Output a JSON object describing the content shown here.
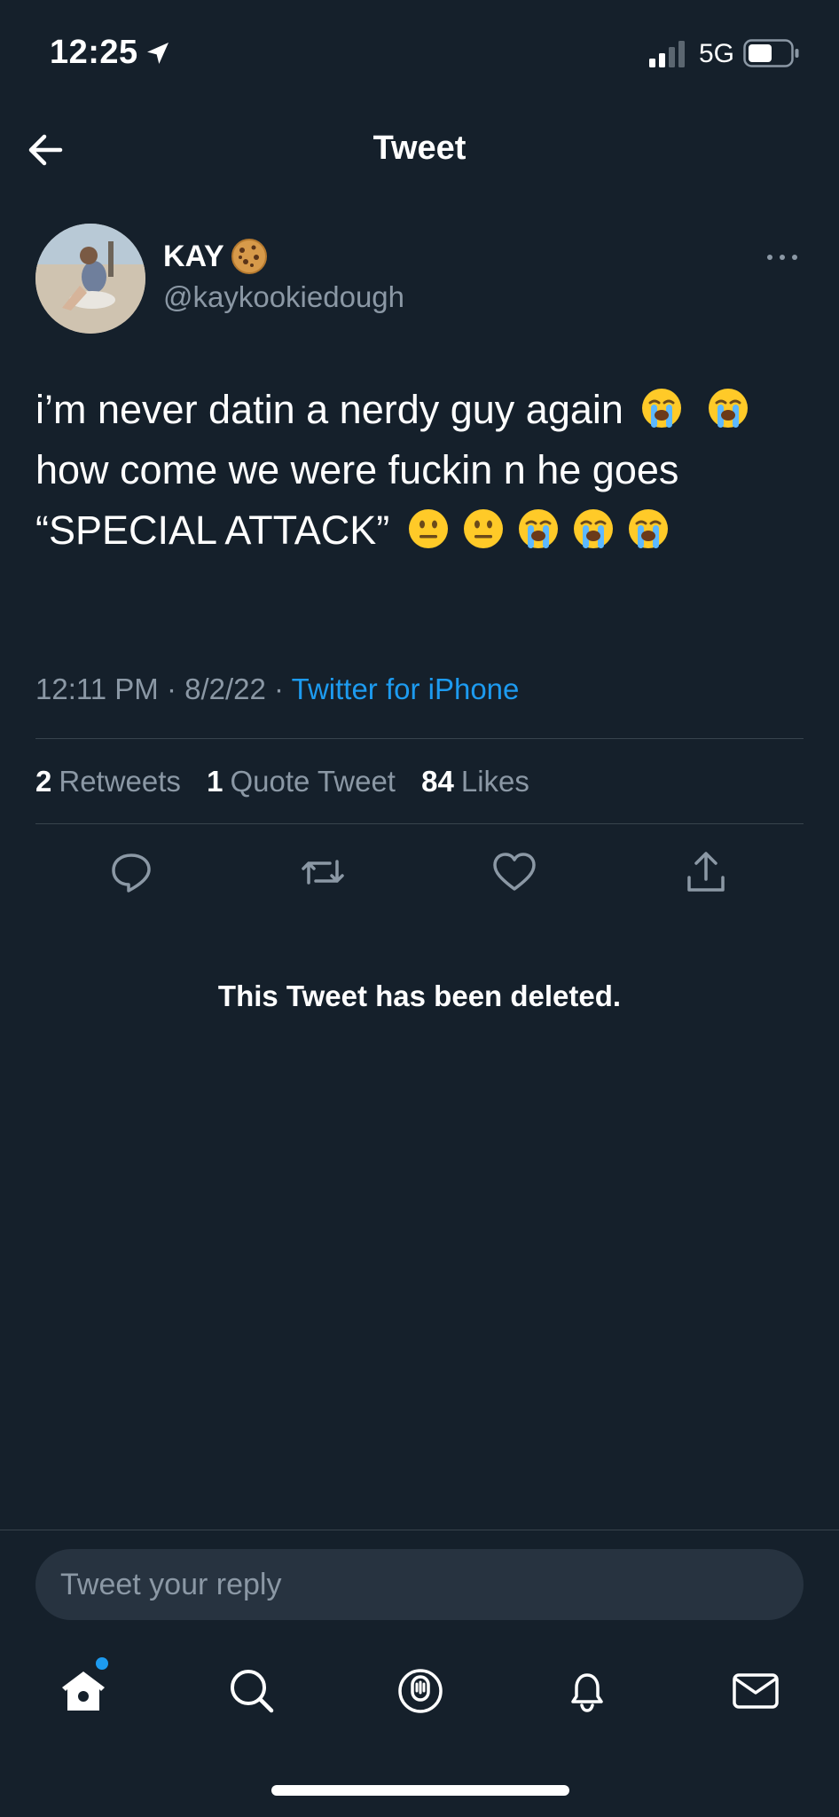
{
  "status_bar": {
    "time": "12:25",
    "network": "5G"
  },
  "nav": {
    "title": "Tweet"
  },
  "tweet": {
    "author_name": "KAY",
    "author_handle": "@kaykookiedough",
    "text_parts": [
      "i’m never datin a nerdy guy again ",
      " how come we were fuckin n he goes “SPECIAL ATTACK” "
    ],
    "timestamp": "12:11 PM · 8/2/22 · ",
    "source": "Twitter for iPhone"
  },
  "stats": {
    "retweets_count": "2",
    "retweets_label": "Retweets",
    "quotes_count": "1",
    "quotes_label": "Quote Tweet",
    "likes_count": "84",
    "likes_label": "Likes"
  },
  "deleted_notice": "This Tweet has been deleted.",
  "reply": {
    "placeholder": "Tweet your reply"
  },
  "colors": {
    "background": "#15202b",
    "accent": "#1d9bf0",
    "secondary_text": "#8b98a5"
  },
  "icons": [
    "location-arrow-icon",
    "signal-icon",
    "battery-icon",
    "back-arrow-icon",
    "cookie-emoji-icon",
    "more-icon",
    "sob-emoji-icon",
    "neutral-face-emoji-icon",
    "reply-icon",
    "retweet-icon",
    "like-icon",
    "share-icon",
    "home-icon",
    "search-icon",
    "spaces-icon",
    "notifications-icon",
    "messages-icon"
  ]
}
